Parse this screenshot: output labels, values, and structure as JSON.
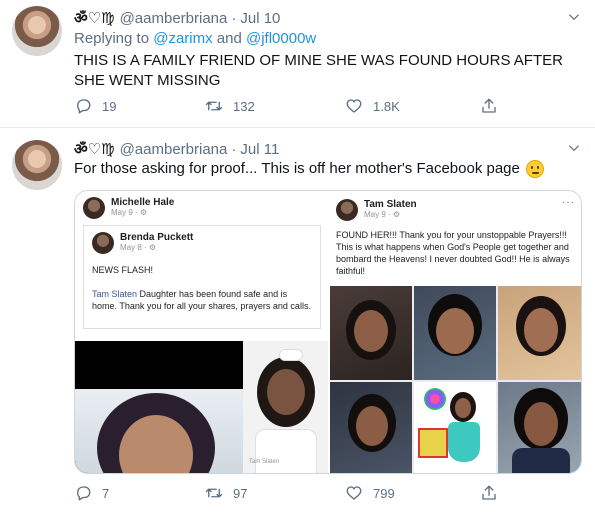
{
  "tweets": [
    {
      "display_name": "ॐ♡♍",
      "handle": "@aamberbriana",
      "separator": "·",
      "date": "Jul 10",
      "replying_prefix": "Replying to",
      "mention1": "@zarimx",
      "and": "and",
      "mention2": "@jfl0000w",
      "text": "THIS IS A FAMILY FRIEND OF MINE SHE WAS FOUND HOURS AFTER SHE WENT MISSING",
      "replies": "19",
      "retweets": "132",
      "likes": "1.8K"
    },
    {
      "display_name": "ॐ♡♍",
      "handle": "@aamberbriana",
      "separator": "·",
      "date": "Jul 11",
      "text": "For those asking for proof... This is off her mother's Facebook page",
      "replies": "7",
      "retweets": "97",
      "likes": "799"
    }
  ],
  "media": {
    "left": {
      "outer_name": "Michelle Hale",
      "outer_meta": "May 9 · ⚙",
      "inner_name": "Brenda Puckett",
      "inner_meta": "May 8 · ⚙",
      "headline": "NEWS FLASH!",
      "link_name": "Tam Slaten",
      "body": " Daughter has been found safe and is home.  Thank you for all your shares, prayers and calls.",
      "photo_caption": "Tam Slaten"
    },
    "right": {
      "name": "Tam Slaten",
      "meta": "May 9 · ⚙",
      "body": "FOUND HER!!! Thank you for your unstoppable Prayers!!! This is what happens when God's People get together and bombard the Heavens! I never doubted God!! He is always faithful!"
    }
  },
  "icons": {
    "caret": "chevron-down-icon",
    "reply": "reply-icon",
    "retweet": "retweet-icon",
    "like": "heart-icon",
    "share": "share-icon"
  },
  "colors": {
    "link": "#1b95e0",
    "secondary_text": "#5b7083",
    "primary_text": "#0f1419",
    "divider": "#e6ecf0",
    "facebook_link": "#385898"
  }
}
